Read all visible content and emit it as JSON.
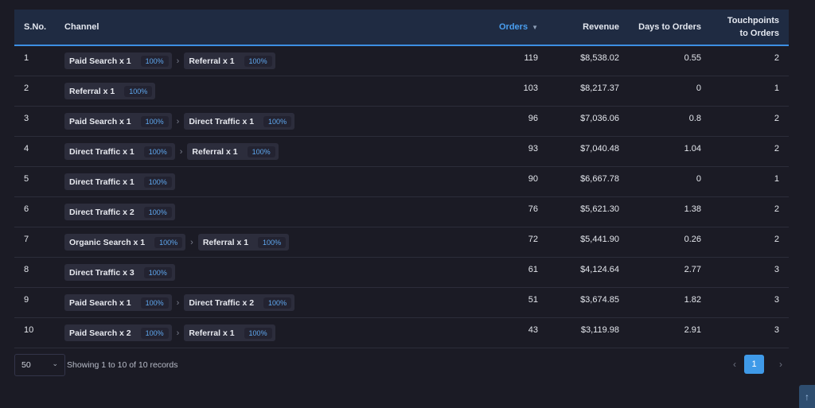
{
  "table": {
    "headers": {
      "sno": "S.No.",
      "channel": "Channel",
      "orders": "Orders",
      "revenue": "Revenue",
      "days": "Days to Orders",
      "touchpoints_line1": "Touchpoints",
      "touchpoints_line2": "to Orders"
    },
    "sort_icon": "sort-down-icon",
    "rows": [
      {
        "sno": "1",
        "channels": [
          {
            "label": "Paid Search x 1",
            "pct": "100%"
          },
          {
            "label": "Referral x 1",
            "pct": "100%"
          }
        ],
        "orders": "119",
        "revenue": "$8,538.02",
        "days": "0.55",
        "touchpoints": "2"
      },
      {
        "sno": "2",
        "channels": [
          {
            "label": "Referral x 1",
            "pct": "100%"
          }
        ],
        "orders": "103",
        "revenue": "$8,217.37",
        "days": "0",
        "touchpoints": "1"
      },
      {
        "sno": "3",
        "channels": [
          {
            "label": "Paid Search x 1",
            "pct": "100%"
          },
          {
            "label": "Direct Traffic x 1",
            "pct": "100%"
          }
        ],
        "orders": "96",
        "revenue": "$7,036.06",
        "days": "0.8",
        "touchpoints": "2"
      },
      {
        "sno": "4",
        "channels": [
          {
            "label": "Direct Traffic x 1",
            "pct": "100%"
          },
          {
            "label": "Referral x 1",
            "pct": "100%"
          }
        ],
        "orders": "93",
        "revenue": "$7,040.48",
        "days": "1.04",
        "touchpoints": "2"
      },
      {
        "sno": "5",
        "channels": [
          {
            "label": "Direct Traffic x 1",
            "pct": "100%"
          }
        ],
        "orders": "90",
        "revenue": "$6,667.78",
        "days": "0",
        "touchpoints": "1"
      },
      {
        "sno": "6",
        "channels": [
          {
            "label": "Direct Traffic x 2",
            "pct": "100%"
          }
        ],
        "orders": "76",
        "revenue": "$5,621.30",
        "days": "1.38",
        "touchpoints": "2"
      },
      {
        "sno": "7",
        "channels": [
          {
            "label": "Organic Search x 1",
            "pct": "100%"
          },
          {
            "label": "Referral x 1",
            "pct": "100%"
          }
        ],
        "orders": "72",
        "revenue": "$5,441.90",
        "days": "0.26",
        "touchpoints": "2"
      },
      {
        "sno": "8",
        "channels": [
          {
            "label": "Direct Traffic x 3",
            "pct": "100%"
          }
        ],
        "orders": "61",
        "revenue": "$4,124.64",
        "days": "2.77",
        "touchpoints": "3"
      },
      {
        "sno": "9",
        "channels": [
          {
            "label": "Paid Search x 1",
            "pct": "100%"
          },
          {
            "label": "Direct Traffic x 2",
            "pct": "100%"
          }
        ],
        "orders": "51",
        "revenue": "$3,674.85",
        "days": "1.82",
        "touchpoints": "3"
      },
      {
        "sno": "10",
        "channels": [
          {
            "label": "Paid Search x 2",
            "pct": "100%"
          },
          {
            "label": "Referral x 1",
            "pct": "100%"
          }
        ],
        "orders": "43",
        "revenue": "$3,119.98",
        "days": "2.91",
        "touchpoints": "3"
      }
    ]
  },
  "footer": {
    "page_size": "50",
    "showing": "Showing 1 to 10 of 10 records",
    "current_page": "1",
    "prev_icon": "chevron-left-icon",
    "next_icon": "chevron-right-icon"
  },
  "colors": {
    "accent": "#3f9ae8",
    "header_bg": "#1f2b42",
    "page_bg": "#1b1b25"
  }
}
